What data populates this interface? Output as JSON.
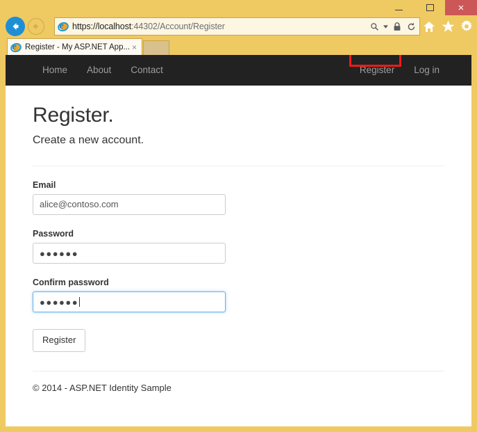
{
  "browser": {
    "window_controls": {
      "minimize": "–",
      "maximize": "▭",
      "close": "×"
    },
    "back_label": "←",
    "forward_label": "→",
    "url": {
      "scheme": "https://",
      "host": "localhost",
      "port": ":44302",
      "path": "/Account/Register",
      "full": "https://localhost:44302/Account/Register"
    },
    "address_icons": {
      "search": "🔍",
      "search_dropdown": "▾",
      "lock": "🔒",
      "refresh": "↻"
    },
    "toolbar_icons": {
      "home": "⌂",
      "favorites": "★",
      "settings": "⚙"
    },
    "tab": {
      "title": "Register - My ASP.NET App...",
      "close": "×"
    }
  },
  "site": {
    "nav_left": [
      {
        "label": "Home"
      },
      {
        "label": "About"
      },
      {
        "label": "Contact"
      }
    ],
    "nav_right": [
      {
        "label": "Register"
      },
      {
        "label": "Log in"
      }
    ],
    "highlight_color": "#ef1a1a",
    "navbar_color": "#222222"
  },
  "page": {
    "title": "Register.",
    "subtitle": "Create a new account.",
    "form": {
      "email": {
        "label": "Email",
        "value": "alice@contoso.com",
        "placeholder": ""
      },
      "password": {
        "label": "Password",
        "value": "●●●●●●",
        "placeholder": ""
      },
      "confirm_password": {
        "label": "Confirm password",
        "value": "●●●●●●",
        "placeholder": "",
        "focused": true
      },
      "submit_label": "Register"
    },
    "footer": "© 2014 - ASP.NET Identity Sample"
  }
}
